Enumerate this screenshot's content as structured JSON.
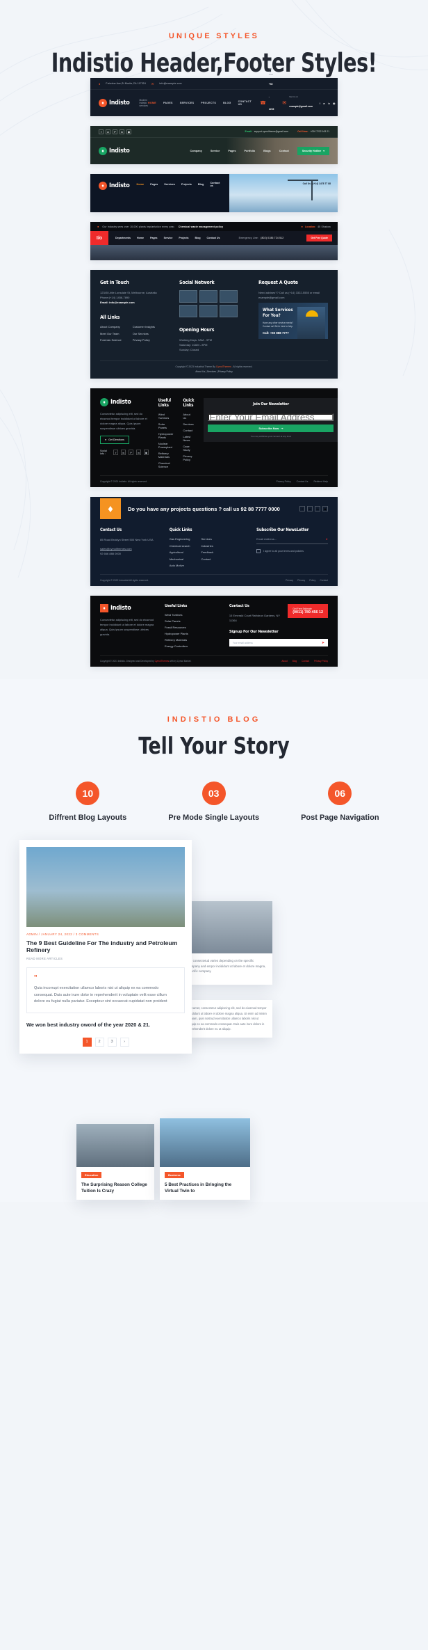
{
  "section1": {
    "kicker": "UNIQUE STYLES",
    "title": "Indistio Header,Footer Styles!"
  },
  "header1": {
    "address": "Fairview Ave,St Murite,CA 117324",
    "email": "info@example.com",
    "brand": "Indisto",
    "tagline": "Modern Indistio services",
    "nav": [
      "HOME",
      "PAGES",
      "SERVICES",
      "PROJECTS",
      "BLOG",
      "CONTACT US"
    ],
    "active_nav": "HOME",
    "call_label": "Call Us Now!",
    "call_number": "+92 - 1203 - 8896",
    "mail_label": "Mail Us At",
    "mail_value": "example@gmail.com",
    "socials": [
      "facebook",
      "twitter",
      "linkedin",
      "instagram"
    ]
  },
  "header2": {
    "socials": [
      "facebook",
      "twitter",
      "pinterest",
      "linkedin",
      "instagram"
    ],
    "email_label": "Email:",
    "email_value": "support.cymoltheme@gmail.com",
    "call_label": "Call Now:",
    "call_value": "+000 7222 163 21",
    "brand": "Indisto",
    "nav": [
      "Company",
      "Service",
      "Pages",
      "Portfolio",
      "Blogs",
      "Contact"
    ],
    "cta": "Security Hotline"
  },
  "header3": {
    "brand": "Indisto",
    "nav": [
      "Home",
      "Pages",
      "Services",
      "Projects",
      "Blog",
      "Contact us"
    ],
    "active_nav": "Home",
    "cta": "Call Us : (+14) 1478 77 88"
  },
  "header4": {
    "ticker": "Our industry sees over 10,000 plants implantation every year.",
    "ticker_bold": "Chemical waste management policy",
    "location_label": "Location:",
    "location_value": "45 Shadow",
    "logo_mark": "I/o",
    "nav": [
      "Departments",
      "Home",
      "Pages",
      "Service",
      "Projects",
      "Blog",
      "Contact Us"
    ],
    "emergency_label": "Emergency Line:",
    "emergency_value": "(802) 0186 724 512",
    "cta": "Get Free Quote"
  },
  "footer1": {
    "col1_title": "Get In Touch",
    "address_label": "Address:",
    "address": "12345 Little Lonsdale St, Melbourne, Australia",
    "phone": "Phone:(+14) 1456-7890",
    "email": "Email: info@example.com",
    "links_title": "All Links",
    "links_a": [
      "About Company",
      "Meet Our Team",
      "Forensic Science"
    ],
    "links_b": [
      "Customer Insights",
      "Our Services",
      "Privacy Policy"
    ],
    "col2_title": "Social Network",
    "hours_title": "Opening Hours",
    "hours": [
      "Working Days: 9AM - 9PM",
      "Saturday: 10AM - 8PM",
      "Sunday: Closed"
    ],
    "col3_title": "Request A Quote",
    "col3_text": "Need advises?? Call us (+14) 3322-5555 or email example@gmail.com",
    "promo_title": "What Services For You?",
    "promo_text": "Have any other service needs? Contact us! We're here to help.",
    "promo_call": "Call: +92 888 7777",
    "copyright": "Copyright © 2023 Industrial Theme By",
    "copyright_link": "CymolThemes",
    "copyright_tail": ". All rights reserved.",
    "bottom_links": [
      "About Us",
      "Services",
      "Privacy Policy"
    ]
  },
  "footer2": {
    "brand": "Indisto",
    "about": "Consectetur adipiscing elit, sed do eiusmod tempor incididunt ut labore et dolore magna aliqua. Quis ipsum suspendisse ultrices gravida.",
    "directions_btn": "Get Directions",
    "social_label": "Social Info :",
    "useful_title": "Useful Links",
    "useful": [
      "Wind Turbines",
      "Solar Panels",
      "Hydropower Plants",
      "Nuclear Powerplant",
      "Refinery Materials",
      "Chemical Science"
    ],
    "quick_title": "Quick Links",
    "quick": [
      "About Us",
      "Services",
      "Contact",
      "Latest News",
      "Case Study",
      "Privacy Policy"
    ],
    "news_title": "Join Our Newsletter",
    "news_placeholder": "Enter Your Email Address",
    "news_btn": "Subscribe Now",
    "news_note": "You may withdraw your consent at any time!",
    "copyright": "Copyright © 2021 Indistio. All rights reserved.",
    "bottom_links": [
      "Privacy Policy",
      "Contact Us",
      "Redirect Help"
    ]
  },
  "footer3": {
    "question": "Do you have any projects questions ? call us 92 88 7777 0000",
    "socials": [
      "facebook",
      "twitter",
      "linkedin",
      "instagram"
    ],
    "contact_title": "Contact Us",
    "contact_address": "85 Road Broklyn Street 500 New York USA",
    "contact_email": "sales@cymolthemes.com",
    "contact_phone": "92 666 888 0000",
    "quick_title": "Quick Links",
    "quick_a": [
      "Gas Engineering",
      "Chemical search",
      "Agricultural",
      "Mechanical",
      "Auto Motive"
    ],
    "quick_b": [
      "Services",
      "Industries",
      "Feedback",
      "Contact"
    ],
    "sub_title": "Subscribe Our NewsLetter",
    "sub_placeholder": "Email Address...",
    "agree": "I agree to all your terms and policies",
    "copyright": "Copyright © 2022 Industrial All rights reserved.",
    "bottom_links": [
      "Privacy",
      "Privacy",
      "Policy",
      "Contact"
    ]
  },
  "footer4": {
    "brand": "Indisto",
    "about": "Consectetur adipiscing elit, sed do eiusmod tempor incididunt ut labore et dolore magna aliqua. Quis ipsum suspendisse ultrices gravida.",
    "useful_title": "Useful Links",
    "useful": [
      "Wind Turbines",
      "Solar Panels",
      "Fossil Resources",
      "Hydropower Plants",
      "Refinery Materials",
      "Energy Controllers"
    ],
    "contact_title": "Contact Us",
    "contact_address": "15 Emerald Court Rathdrun Gardens, NY 11364",
    "quote_label": "Get Free Estimate",
    "quote_number": "(0011) 789 456 12",
    "signup_title": "Signup For Our Newsletter",
    "signup_placeholder": "Your email address",
    "copyright": "Copyright © 2021 Indistio. Designed and Developed by",
    "copyright_link": "CymolThemes",
    "copyright_tail": " with by Cymol Market.",
    "bottom_links": [
      "About",
      "Blog",
      "Contact",
      "Privacy Policy"
    ]
  },
  "section2": {
    "kicker": "INDISTIO BLOG",
    "title": "Tell Your Story",
    "stats": [
      {
        "number": "10",
        "label": "Diffrent Blog Layouts"
      },
      {
        "number": "03",
        "label": "Pre Mode Single Layouts"
      },
      {
        "number": "06",
        "label": "Post Page Navigation"
      }
    ],
    "card1": {
      "meta": "ADMIN  /  JANUARY 24, 2022  /  3 COMMENTS",
      "title": "The 9 Best Guideline For The industry and Petroleum Refinery",
      "read_more": "READ MORE ARTICLES",
      "quote_mark": "”",
      "quote": "Quia incorrupt exercitation ullamco laboris nisi ut aliquip ex ea commodo consequat. Duis aute irure dolor in reprehenderit in voluptate velit esse cillum dolore eu fugiat nulla pariatur. Excepteur sint occaecat cupidatat non proident",
      "footer_note": "We won best industry oword of the year 2020 & 21.",
      "pager": [
        "1",
        "2",
        "3",
        "›"
      ],
      "pager_active": "1"
    },
    "card2": {
      "text": "ore consectetud varies depending on the specific company and empor incididunt ut labore et dolore magna, specific company"
    },
    "card3": {
      "text": "r sit amet, consectetur adipiscing elit, sed do eiusmod tempor incididunt ut labore et dolore magna aliqua. Ut enim ad minim veniam, quis nostrud exercitation ullamco laboris nisi ut aliquip ex ea commodo consequat. Duis aute irure dolore in reprehenderit dolore eu ut aliquip."
    },
    "card4": {
      "tag": "Education",
      "title": "The Surprising Reason College Tuition Is Crazy"
    },
    "card5": {
      "tag": "Business",
      "title": "5 Best Practices in Bringing the Virtual Twin to"
    }
  }
}
